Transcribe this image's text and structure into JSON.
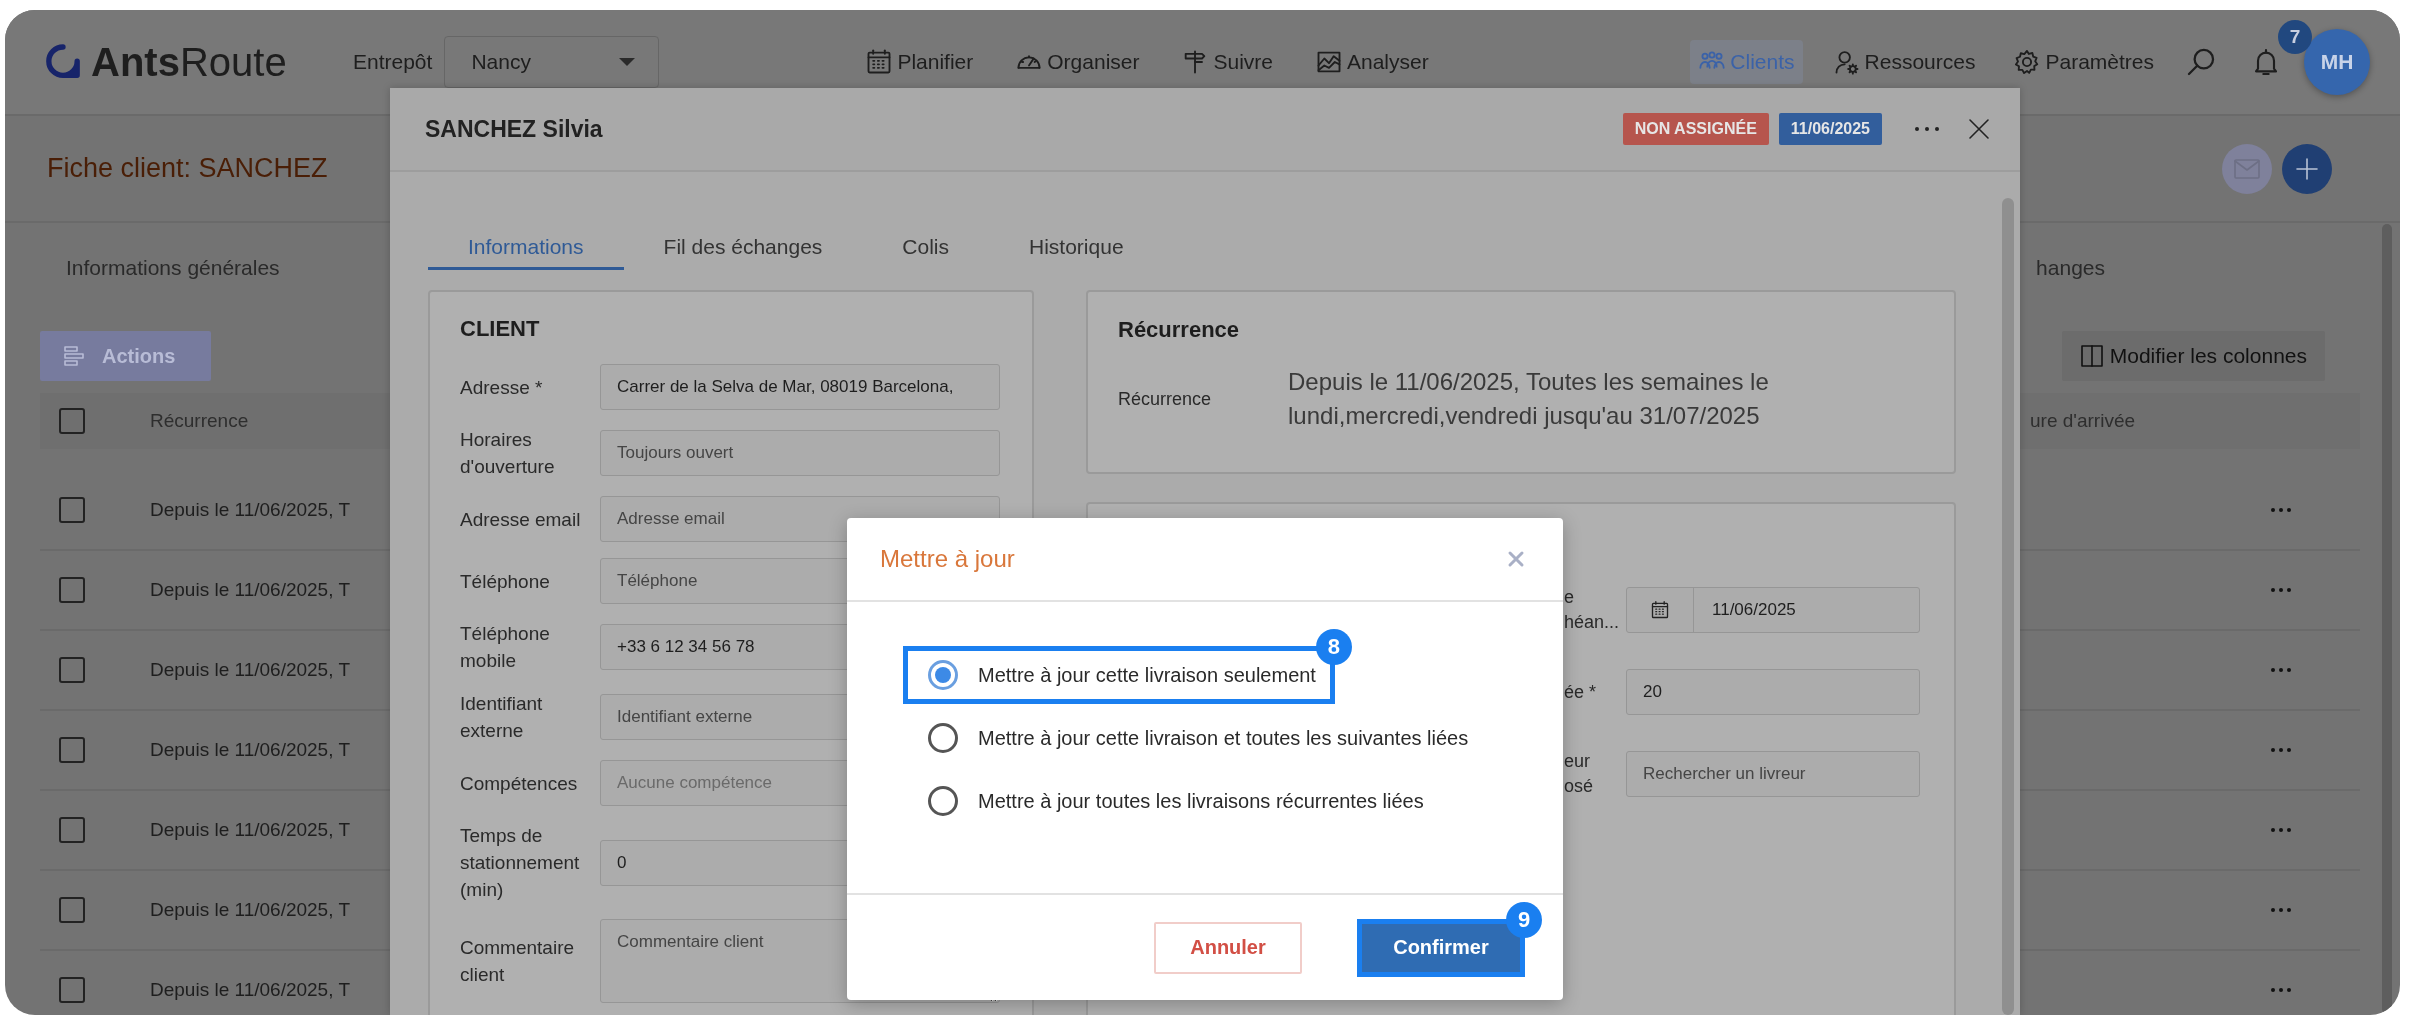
{
  "app": {
    "logo_bold": "Ants",
    "logo_light": "Route",
    "warehouse_label": "Entrepôt",
    "warehouse": "Nancy",
    "nav": [
      {
        "label": "Planifier",
        "selected": false
      },
      {
        "label": "Organiser",
        "selected": false
      },
      {
        "label": "Suivre",
        "selected": false
      },
      {
        "label": "Analyser",
        "selected": false
      }
    ],
    "nav_right": [
      {
        "label": "Clients",
        "selected": true
      },
      {
        "label": "Ressources",
        "selected": false
      },
      {
        "label": "Paramètres",
        "selected": false
      }
    ],
    "notifications": "7",
    "avatar": "MH"
  },
  "page": {
    "title": "Fiche client: SANCHEZ",
    "tabs": [
      {
        "label": "Informations générales"
      },
      {
        "label": "hanges"
      }
    ],
    "actions_button": "Actions",
    "columns_button": "Modifier les colonnes",
    "table": {
      "columns": [
        "Récurrence",
        "ure d'arrivée"
      ],
      "header_checked": false,
      "rows": [
        {
          "recurrence": "Depuis le 11/06/2025, T",
          "checked": false
        },
        {
          "recurrence": "Depuis le 11/06/2025, T",
          "checked": false
        },
        {
          "recurrence": "Depuis le 11/06/2025, T",
          "checked": false
        },
        {
          "recurrence": "Depuis le 11/06/2025, T",
          "checked": false
        },
        {
          "recurrence": "Depuis le 11/06/2025, T",
          "checked": false
        },
        {
          "recurrence": "Depuis le 11/06/2025, T",
          "checked": false
        },
        {
          "recurrence": "Depuis le 11/06/2025, T",
          "checked": false
        }
      ]
    }
  },
  "client_modal": {
    "title": "SANCHEZ Silvia",
    "badges": [
      {
        "label": "NON ASSIGNÉE",
        "color": "#b6554d"
      },
      {
        "label": "11/06/2025",
        "color": "#325e9c"
      }
    ],
    "tabs": [
      {
        "label": "Informations",
        "selected": true
      },
      {
        "label": "Fil des échanges",
        "selected": false
      },
      {
        "label": "Colis",
        "selected": false
      },
      {
        "label": "Historique",
        "selected": false
      }
    ],
    "client_card": {
      "title": "CLIENT",
      "fields": [
        {
          "label": "Adresse *",
          "kind": "input",
          "value": "Carrer de la Selva de Mar, 08019 Barcelona,"
        },
        {
          "label": "Horaires d'ouverture",
          "kind": "input",
          "placeholder": "Toujours ouvert"
        },
        {
          "label": "Adresse email",
          "kind": "input",
          "placeholder": "Adresse email"
        },
        {
          "label": "Téléphone",
          "kind": "input",
          "placeholder": "Téléphone"
        },
        {
          "label": "Téléphone mobile",
          "kind": "input",
          "value": "+33 6 12 34 56 78"
        },
        {
          "label": "Identifiant externe",
          "kind": "input",
          "placeholder": "Identifiant externe"
        },
        {
          "label": "Compétences",
          "kind": "select",
          "placeholder": "Aucune compétence"
        },
        {
          "label": "Temps de stationnement (min)",
          "kind": "input",
          "value": "0"
        },
        {
          "label": "Commentaire client",
          "kind": "textarea",
          "placeholder": "Commentaire client"
        }
      ]
    },
    "recurrence_card": {
      "title": "Récurrence",
      "label": "Récurrence",
      "text": "Depuis le 11/06/2025, Toutes les semaines le lundi,mercredi,vendredi jusqu'au 31/07/2025"
    },
    "delivery_card": {
      "fields": [
        {
          "label_lines": [
            "e",
            "héan..."
          ],
          "kind": "date",
          "value": "11/06/2025"
        },
        {
          "label_lines": [
            "ée *"
          ],
          "kind": "input",
          "value": "20"
        },
        {
          "label_lines": [
            "eur",
            "osé"
          ],
          "kind": "input",
          "placeholder": "Rechercher un livreur"
        }
      ]
    }
  },
  "dialog": {
    "title": "Mettre à jour",
    "options": [
      {
        "label": "Mettre à jour cette livraison seulement",
        "selected": true,
        "callout": "8"
      },
      {
        "label": "Mettre à jour cette livraison et toutes les suivantes liées",
        "selected": false
      },
      {
        "label": "Mettre à jour toutes les livraisons récurrentes liées",
        "selected": false
      }
    ],
    "cancel": {
      "label": "Annuler"
    },
    "confirm": {
      "label": "Confirmer",
      "callout": "9"
    }
  }
}
